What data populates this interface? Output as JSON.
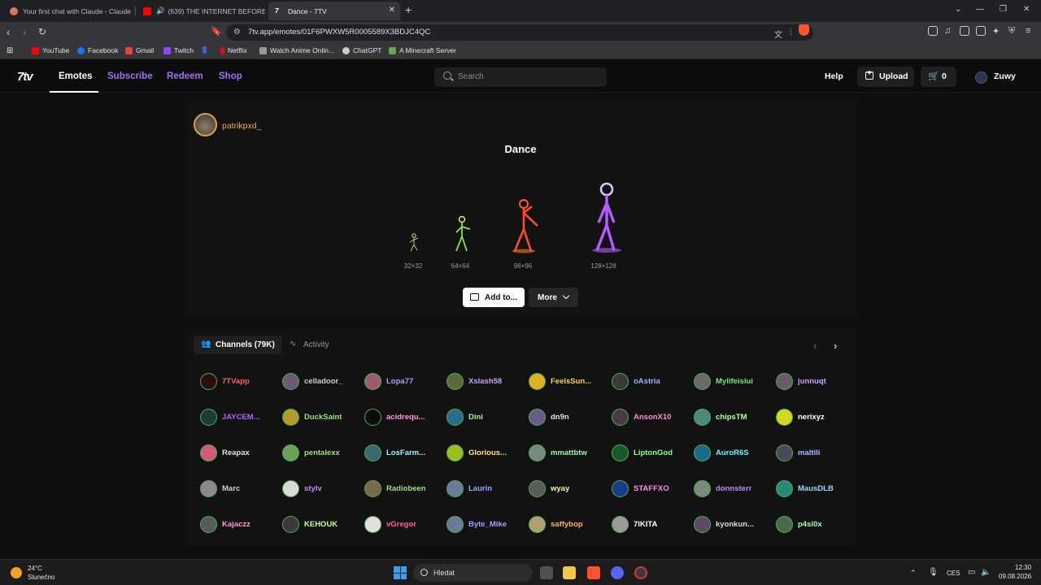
{
  "browser": {
    "tabs": [
      {
        "title": "Your first chat with Claude - Claude",
        "color": "#d97757"
      },
      {
        "title": "(639) THE INTERNET BEFORE MI",
        "color": "#ff0000"
      },
      {
        "title": "Dance - 7TV",
        "color": "#ffffff"
      }
    ],
    "close_glyph": "✕",
    "newtab_glyph": "+",
    "url": "7tv.app/emotes/01F6PWXW5R0005589X3BDJC4QC",
    "bookmarks": [
      {
        "label": "YouTube",
        "color": "#ff0000"
      },
      {
        "label": "Facebook",
        "color": "#1877f2"
      },
      {
        "label": "Gmail",
        "color": "#ea4335"
      },
      {
        "label": "Twitch",
        "color": "#9146ff"
      },
      {
        "label": "",
        "color": "#3b5fd9"
      },
      {
        "label": "Netflix",
        "color": "#e50914"
      },
      {
        "label": "Watch Anime Onlin...",
        "color": "#999999"
      },
      {
        "label": "ChatGPT",
        "color": "#cccccc"
      },
      {
        "label": "A Minecraft Server",
        "color": "#6aa84f"
      }
    ]
  },
  "site": {
    "logo": "7tv",
    "nav": [
      {
        "label": "Emotes",
        "color": "#ffffff",
        "active": true
      },
      {
        "label": "Subscribe",
        "color": "#a56cff"
      },
      {
        "label": "Redeem",
        "color": "#a56cff"
      },
      {
        "label": "Shop",
        "color": "#a56cff"
      }
    ],
    "search_placeholder": "Search",
    "help": "Help",
    "upload": "Upload",
    "cart_count": "0",
    "username": "Zuwy"
  },
  "emote": {
    "author": "patrikpxd_",
    "name": "Dance",
    "sizes": [
      "32×32",
      "64×64",
      "96×96",
      "128×128"
    ],
    "add_label": "Add to...",
    "more_label": "More"
  },
  "channels_section": {
    "tab_channels": "Channels (79K)",
    "tab_activity": "Activity",
    "channels": [
      {
        "name": "7TVapp",
        "color": "#ff5d5d",
        "av": "#2b0f0f"
      },
      {
        "name": "celladoor_",
        "color": "#cfcfcf",
        "av": "#6b5a78"
      },
      {
        "name": "Lopa77",
        "color": "#b49cf0",
        "av": "#a05a6e"
      },
      {
        "name": "Xslash58",
        "color": "#caa0ff",
        "av": "#5a6a3a"
      },
      {
        "name": "FeelsSun...",
        "color": "#f2d35e",
        "av": "#e0b020"
      },
      {
        "name": "oAstria",
        "color": "#9fb3ff",
        "av": "#3a3a3a"
      },
      {
        "name": "Mylifeisiui",
        "color": "#7ee07e",
        "av": "#6a6a6a"
      },
      {
        "name": "junnuqt",
        "color": "#c9a0ff",
        "av": "#6a5a6a"
      },
      {
        "name": "JAYCEM...",
        "color": "#b166ff",
        "av": "#1f3a3a"
      },
      {
        "name": "DuckSaint",
        "color": "#9de07a",
        "av": "#b59a2a"
      },
      {
        "name": "acidrequ...",
        "color": "#ff9de0",
        "av": "#0b0b0b"
      },
      {
        "name": "Dini",
        "color": "#9df5a0",
        "av": "#2a6a8a"
      },
      {
        "name": "dn9n",
        "color": "#e0e0e0",
        "av": "#6a5a8a"
      },
      {
        "name": "AnsonX10",
        "color": "#ff8fd2",
        "av": "#4a3a4a"
      },
      {
        "name": "chipsTM",
        "color": "#b8ff9a",
        "av": "#4a8a7a"
      },
      {
        "name": "nerixyz",
        "color": "#ffffff",
        "av": "#d6d620"
      },
      {
        "name": "Reapax",
        "color": "#e0e0e0",
        "av": "#d05a7a"
      },
      {
        "name": "pentalexx",
        "color": "#9de08a",
        "av": "#6aa05a"
      },
      {
        "name": "LosFarm...",
        "color": "#a8f0ff",
        "av": "#3a6a6a"
      },
      {
        "name": "Glorious...",
        "color": "#ffe08a",
        "av": "#9ac020"
      },
      {
        "name": "mmattbtw",
        "color": "#9df0b0",
        "av": "#7a8a7a"
      },
      {
        "name": "LiptonGod",
        "color": "#8fff9a",
        "av": "#1a5a2a"
      },
      {
        "name": "AuroR6S",
        "color": "#6ff0ff",
        "av": "#1a6a8a"
      },
      {
        "name": "maltili",
        "color": "#a0c0ff",
        "av": "#4a4a5a"
      },
      {
        "name": "Marc",
        "color": "#cfcfcf",
        "av": "#8a8a8a"
      },
      {
        "name": "stylv",
        "color": "#c58aff",
        "av": "#dadada"
      },
      {
        "name": "Radiobeen",
        "color": "#9de07a",
        "av": "#7a6a4a"
      },
      {
        "name": "Laurin",
        "color": "#9aa8ff",
        "av": "#6a7a9a"
      },
      {
        "name": "wyay",
        "color": "#e0ffa0",
        "av": "#5a5a5a"
      },
      {
        "name": "STAFFXO",
        "color": "#ff8fe0",
        "av": "#1a3a8a"
      },
      {
        "name": "donnsterr",
        "color": "#b08aff",
        "av": "#7a8a7a"
      },
      {
        "name": "MausDLB",
        "color": "#9fd6ff",
        "av": "#2a8a7a"
      },
      {
        "name": "Kajaczz",
        "color": "#ff9ad8",
        "av": "#5a5a5a"
      },
      {
        "name": "KEHOUK",
        "color": "#c5ff8a",
        "av": "#3a3a3a"
      },
      {
        "name": "vGregor",
        "color": "#ff5fa0",
        "av": "#e0e0e0"
      },
      {
        "name": "Byte_Mike",
        "color": "#a0a0ff",
        "av": "#6a7a9a"
      },
      {
        "name": "saffybop",
        "color": "#ffb04a",
        "av": "#b0a070"
      },
      {
        "name": "7IKITA",
        "color": "#ffffff",
        "av": "#9a9a9a"
      },
      {
        "name": "kyonkun...",
        "color": "#dadada",
        "av": "#5a4a6a"
      },
      {
        "name": "p4si0x",
        "color": "#a0ffb0",
        "av": "#4a6a4a"
      }
    ]
  },
  "taskbar": {
    "temp": "24°C",
    "weather": "Slunečno",
    "search": "Hledat",
    "lang": "CES",
    "time": "12:30",
    "date": "09.08.2026"
  }
}
